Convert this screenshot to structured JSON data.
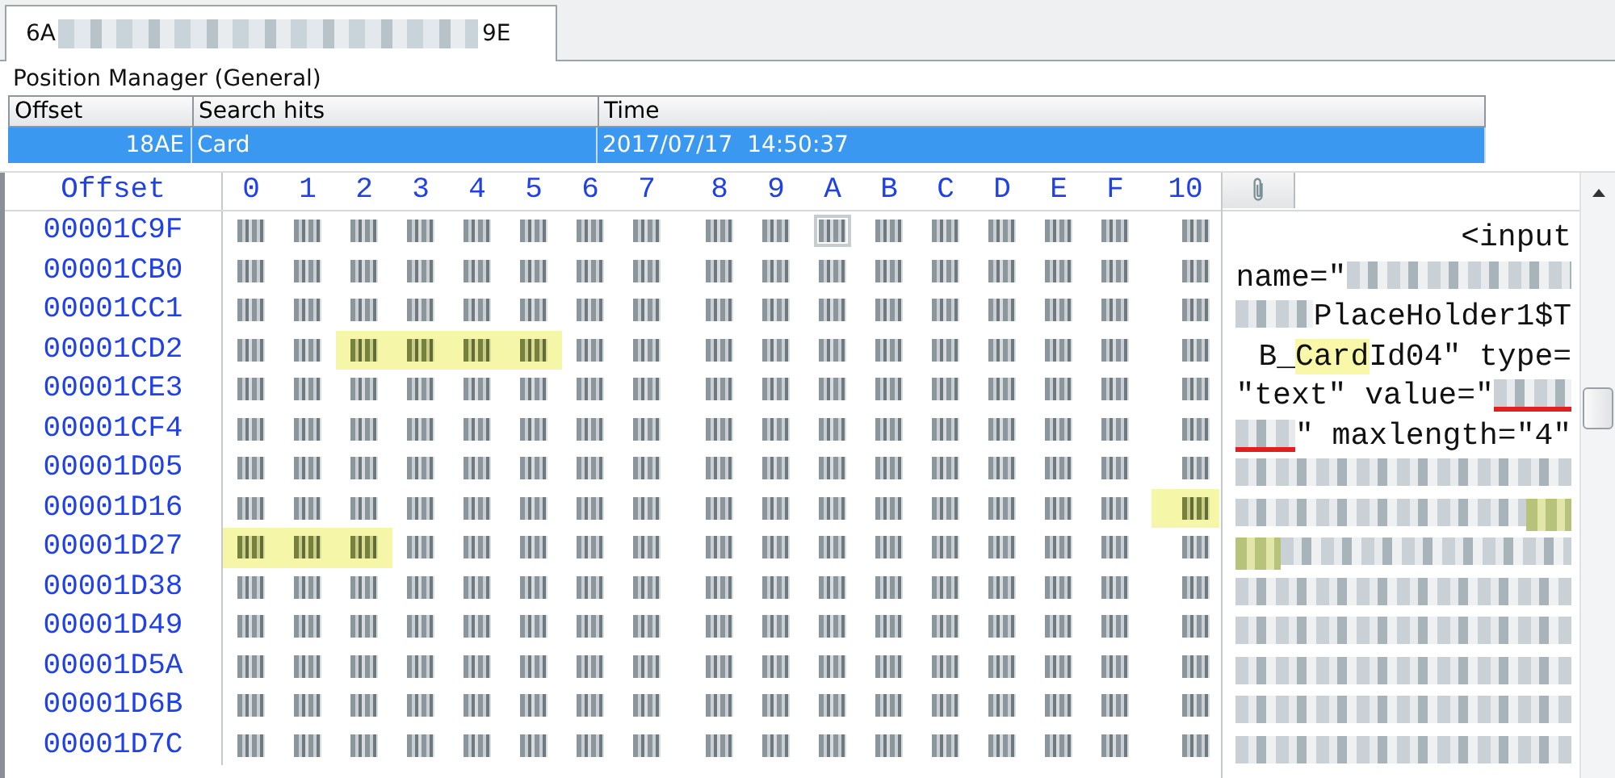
{
  "tab_bar": {
    "tabs": [
      {
        "selected": true,
        "segments": [
          {
            "kind": "text",
            "text": "6A"
          },
          {
            "kind": "redacted"
          },
          {
            "kind": "text",
            "text": "9E"
          }
        ]
      }
    ]
  },
  "position_manager": {
    "title": "Position Manager (General)",
    "columns": [
      "Offset",
      "Search hits",
      "Time"
    ],
    "rows": [
      {
        "selected": true,
        "cells": [
          "18AE",
          "Card",
          "2017/07/17  14:50:37"
        ]
      }
    ]
  },
  "hex_view": {
    "offset_header": "Offset",
    "column_headers": [
      "0",
      "1",
      "2",
      "3",
      "4",
      "5",
      "6",
      "7",
      "8",
      "9",
      "A",
      "B",
      "C",
      "D",
      "E",
      "F",
      "10"
    ],
    "rows": [
      {
        "offset": "00001C9F",
        "cells": [
          {
            "highlighted": false
          },
          {
            "highlighted": false
          },
          {
            "highlighted": false
          },
          {
            "highlighted": false
          },
          {
            "highlighted": false
          },
          {
            "highlighted": false
          },
          {
            "highlighted": false
          },
          {
            "highlighted": false
          },
          {
            "highlighted": false
          },
          {
            "highlighted": false
          },
          {
            "highlighted": false,
            "cursor": true
          },
          {
            "highlighted": false
          },
          {
            "highlighted": false
          },
          {
            "highlighted": false
          },
          {
            "highlighted": false
          },
          {
            "highlighted": false
          },
          {
            "highlighted": false
          }
        ]
      },
      {
        "offset": "00001CB0",
        "cells": [
          {
            "highlighted": false
          },
          {
            "highlighted": false
          },
          {
            "highlighted": false
          },
          {
            "highlighted": false
          },
          {
            "highlighted": false
          },
          {
            "highlighted": false
          },
          {
            "highlighted": false
          },
          {
            "highlighted": false
          },
          {
            "highlighted": false
          },
          {
            "highlighted": false
          },
          {
            "highlighted": false
          },
          {
            "highlighted": false
          },
          {
            "highlighted": false
          },
          {
            "highlighted": false
          },
          {
            "highlighted": false
          },
          {
            "highlighted": false
          },
          {
            "highlighted": false
          }
        ]
      },
      {
        "offset": "00001CC1",
        "cells": [
          {
            "highlighted": false
          },
          {
            "highlighted": false
          },
          {
            "highlighted": false
          },
          {
            "highlighted": false
          },
          {
            "highlighted": false
          },
          {
            "highlighted": false
          },
          {
            "highlighted": false
          },
          {
            "highlighted": false
          },
          {
            "highlighted": false
          },
          {
            "highlighted": false
          },
          {
            "highlighted": false
          },
          {
            "highlighted": false
          },
          {
            "highlighted": false
          },
          {
            "highlighted": false
          },
          {
            "highlighted": false
          },
          {
            "highlighted": false
          },
          {
            "highlighted": false
          }
        ]
      },
      {
        "offset": "00001CD2",
        "cells": [
          {
            "highlighted": false
          },
          {
            "highlighted": false
          },
          {
            "highlighted": true
          },
          {
            "highlighted": true
          },
          {
            "highlighted": true
          },
          {
            "highlighted": true
          },
          {
            "highlighted": false
          },
          {
            "highlighted": false
          },
          {
            "highlighted": false
          },
          {
            "highlighted": false
          },
          {
            "highlighted": false
          },
          {
            "highlighted": false
          },
          {
            "highlighted": false
          },
          {
            "highlighted": false
          },
          {
            "highlighted": false
          },
          {
            "highlighted": false
          },
          {
            "highlighted": false
          }
        ]
      },
      {
        "offset": "00001CE3",
        "cells": [
          {
            "highlighted": false
          },
          {
            "highlighted": false
          },
          {
            "highlighted": false
          },
          {
            "highlighted": false
          },
          {
            "highlighted": false
          },
          {
            "highlighted": false
          },
          {
            "highlighted": false
          },
          {
            "highlighted": false
          },
          {
            "highlighted": false
          },
          {
            "highlighted": false
          },
          {
            "highlighted": false
          },
          {
            "highlighted": false
          },
          {
            "highlighted": false
          },
          {
            "highlighted": false
          },
          {
            "highlighted": false
          },
          {
            "highlighted": false
          },
          {
            "highlighted": false
          }
        ]
      },
      {
        "offset": "00001CF4",
        "cells": [
          {
            "highlighted": false
          },
          {
            "highlighted": false
          },
          {
            "highlighted": false
          },
          {
            "highlighted": false
          },
          {
            "highlighted": false
          },
          {
            "highlighted": false
          },
          {
            "highlighted": false
          },
          {
            "highlighted": false
          },
          {
            "highlighted": false
          },
          {
            "highlighted": false
          },
          {
            "highlighted": false
          },
          {
            "highlighted": false
          },
          {
            "highlighted": false
          },
          {
            "highlighted": false
          },
          {
            "highlighted": false
          },
          {
            "highlighted": false
          },
          {
            "highlighted": false
          }
        ]
      },
      {
        "offset": "00001D05",
        "cells": [
          {
            "highlighted": false
          },
          {
            "highlighted": false
          },
          {
            "highlighted": false
          },
          {
            "highlighted": false
          },
          {
            "highlighted": false
          },
          {
            "highlighted": false
          },
          {
            "highlighted": false
          },
          {
            "highlighted": false
          },
          {
            "highlighted": false
          },
          {
            "highlighted": false
          },
          {
            "highlighted": false
          },
          {
            "highlighted": false
          },
          {
            "highlighted": false
          },
          {
            "highlighted": false
          },
          {
            "highlighted": false
          },
          {
            "highlighted": false
          },
          {
            "highlighted": false
          }
        ]
      },
      {
        "offset": "00001D16",
        "cells": [
          {
            "highlighted": false
          },
          {
            "highlighted": false
          },
          {
            "highlighted": false
          },
          {
            "highlighted": false
          },
          {
            "highlighted": false
          },
          {
            "highlighted": false
          },
          {
            "highlighted": false
          },
          {
            "highlighted": false
          },
          {
            "highlighted": false
          },
          {
            "highlighted": false
          },
          {
            "highlighted": false
          },
          {
            "highlighted": false
          },
          {
            "highlighted": false
          },
          {
            "highlighted": false
          },
          {
            "highlighted": false
          },
          {
            "highlighted": false
          },
          {
            "highlighted": true
          }
        ]
      },
      {
        "offset": "00001D27",
        "cells": [
          {
            "highlighted": true
          },
          {
            "highlighted": true
          },
          {
            "highlighted": true
          },
          {
            "highlighted": false
          },
          {
            "highlighted": false
          },
          {
            "highlighted": false
          },
          {
            "highlighted": false
          },
          {
            "highlighted": false
          },
          {
            "highlighted": false
          },
          {
            "highlighted": false
          },
          {
            "highlighted": false
          },
          {
            "highlighted": false
          },
          {
            "highlighted": false
          },
          {
            "highlighted": false
          },
          {
            "highlighted": false
          },
          {
            "highlighted": false
          },
          {
            "highlighted": false
          }
        ]
      },
      {
        "offset": "00001D38",
        "cells": [
          {
            "highlighted": false
          },
          {
            "highlighted": false
          },
          {
            "highlighted": false
          },
          {
            "highlighted": false
          },
          {
            "highlighted": false
          },
          {
            "highlighted": false
          },
          {
            "highlighted": false
          },
          {
            "highlighted": false
          },
          {
            "highlighted": false
          },
          {
            "highlighted": false
          },
          {
            "highlighted": false
          },
          {
            "highlighted": false
          },
          {
            "highlighted": false
          },
          {
            "highlighted": false
          },
          {
            "highlighted": false
          },
          {
            "highlighted": false
          },
          {
            "highlighted": false
          }
        ]
      },
      {
        "offset": "00001D49",
        "cells": [
          {
            "highlighted": false
          },
          {
            "highlighted": false
          },
          {
            "highlighted": false
          },
          {
            "highlighted": false
          },
          {
            "highlighted": false
          },
          {
            "highlighted": false
          },
          {
            "highlighted": false
          },
          {
            "highlighted": false
          },
          {
            "highlighted": false
          },
          {
            "highlighted": false
          },
          {
            "highlighted": false
          },
          {
            "highlighted": false
          },
          {
            "highlighted": false
          },
          {
            "highlighted": false
          },
          {
            "highlighted": false
          },
          {
            "highlighted": false
          },
          {
            "highlighted": false
          }
        ]
      },
      {
        "offset": "00001D5A",
        "cells": [
          {
            "highlighted": false
          },
          {
            "highlighted": false
          },
          {
            "highlighted": false
          },
          {
            "highlighted": false
          },
          {
            "highlighted": false
          },
          {
            "highlighted": false
          },
          {
            "highlighted": false
          },
          {
            "highlighted": false
          },
          {
            "highlighted": false
          },
          {
            "highlighted": false
          },
          {
            "highlighted": false
          },
          {
            "highlighted": false
          },
          {
            "highlighted": false
          },
          {
            "highlighted": false
          },
          {
            "highlighted": false
          },
          {
            "highlighted": false
          },
          {
            "highlighted": false
          }
        ]
      },
      {
        "offset": "00001D6B",
        "cells": [
          {
            "highlighted": false
          },
          {
            "highlighted": false
          },
          {
            "highlighted": false
          },
          {
            "highlighted": false
          },
          {
            "highlighted": false
          },
          {
            "highlighted": false
          },
          {
            "highlighted": false
          },
          {
            "highlighted": false
          },
          {
            "highlighted": false
          },
          {
            "highlighted": false
          },
          {
            "highlighted": false
          },
          {
            "highlighted": false
          },
          {
            "highlighted": false
          },
          {
            "highlighted": false
          },
          {
            "highlighted": false
          },
          {
            "highlighted": false
          },
          {
            "highlighted": false
          }
        ]
      },
      {
        "offset": "00001D7C",
        "cells": [
          {
            "highlighted": false
          },
          {
            "highlighted": false
          },
          {
            "highlighted": false
          },
          {
            "highlighted": false
          },
          {
            "highlighted": false
          },
          {
            "highlighted": false
          },
          {
            "highlighted": false
          },
          {
            "highlighted": false
          },
          {
            "highlighted": false
          },
          {
            "highlighted": false
          },
          {
            "highlighted": false
          },
          {
            "highlighted": false
          },
          {
            "highlighted": false
          },
          {
            "highlighted": false
          },
          {
            "highlighted": false
          },
          {
            "highlighted": false
          },
          {
            "highlighted": false
          }
        ]
      }
    ],
    "text_pane": {
      "lines": [
        [
          {
            "kind": "text",
            "text": "<input",
            "highlighted": false
          }
        ],
        [
          {
            "kind": "text",
            "text": "name=\"",
            "highlighted": false
          },
          {
            "kind": "redacted",
            "highlighted": false
          }
        ],
        [
          {
            "kind": "redacted",
            "highlighted": false
          },
          {
            "kind": "text",
            "text": "PlaceHolder1$T",
            "highlighted": false
          }
        ],
        [
          {
            "kind": "text",
            "text": "B_",
            "highlighted": false
          },
          {
            "kind": "text",
            "text": "Card",
            "highlighted": true
          },
          {
            "kind": "text",
            "text": "Id04\" type=",
            "highlighted": false
          }
        ],
        [
          {
            "kind": "text",
            "text": "\"text\" value=\"",
            "highlighted": false
          },
          {
            "kind": "redacted",
            "highlighted": false,
            "underlined": true
          }
        ],
        [
          {
            "kind": "redacted",
            "highlighted": false,
            "underlined": true
          },
          {
            "kind": "text",
            "text": "\" maxlength=\"4\"",
            "highlighted": false
          }
        ],
        [
          {
            "kind": "redacted",
            "highlighted": false
          }
        ],
        [
          {
            "kind": "redacted",
            "highlighted": false
          },
          {
            "kind": "redacted",
            "highlighted": true
          }
        ],
        [
          {
            "kind": "redacted",
            "highlighted": true
          },
          {
            "kind": "redacted",
            "highlighted": false
          }
        ],
        [
          {
            "kind": "redacted",
            "highlighted": false
          }
        ],
        [
          {
            "kind": "redacted",
            "highlighted": false
          }
        ],
        [
          {
            "kind": "redacted",
            "highlighted": false
          }
        ],
        [
          {
            "kind": "redacted",
            "highlighted": false
          }
        ],
        [
          {
            "kind": "redacted",
            "highlighted": false
          }
        ]
      ]
    }
  }
}
